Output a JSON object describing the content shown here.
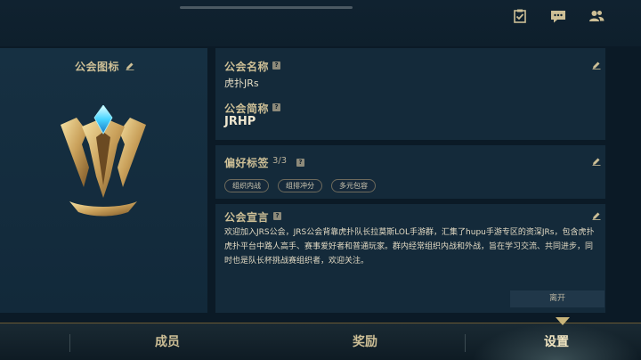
{
  "top_icons": [
    "clipboard-check-icon",
    "chat-bubble-icon",
    "group-icon"
  ],
  "emblem_section": {
    "title": "公会图标",
    "edit_icon": "pencil-icon"
  },
  "guild_name": {
    "label": "公会名称",
    "info_icon": "?",
    "value": "虎扑JRs"
  },
  "guild_abbr": {
    "label": "公会简称",
    "info_icon": "?",
    "value": "JRHP"
  },
  "tags": {
    "label": "偏好标签",
    "count": "3/3",
    "info_icon": "?",
    "items": [
      "组织内战",
      "组排冲分",
      "多元包容"
    ]
  },
  "declaration": {
    "label": "公会宣言",
    "info_icon": "?",
    "text": "欢迎加入JRS公会，JRS公会背靠虎扑队长拉莫斯LOL手游群，汇集了hupu手游专区的资深JRs，包含虎扑虎扑平台中路人高手、赛事爱好者和普通玩家。群内经常组织内战和外战，旨在学习交流、共同进步，同时也是队长杯挑战赛组织者，欢迎关注。"
  },
  "leave_button": "离开",
  "bottom_nav": {
    "tabs": [
      "成员",
      "奖励",
      "设置"
    ],
    "active": "设置"
  },
  "colors": {
    "gold": "#cdbf96",
    "background": "#0b1a26",
    "panel": "#142a3a",
    "accent": "#6a5a33"
  }
}
